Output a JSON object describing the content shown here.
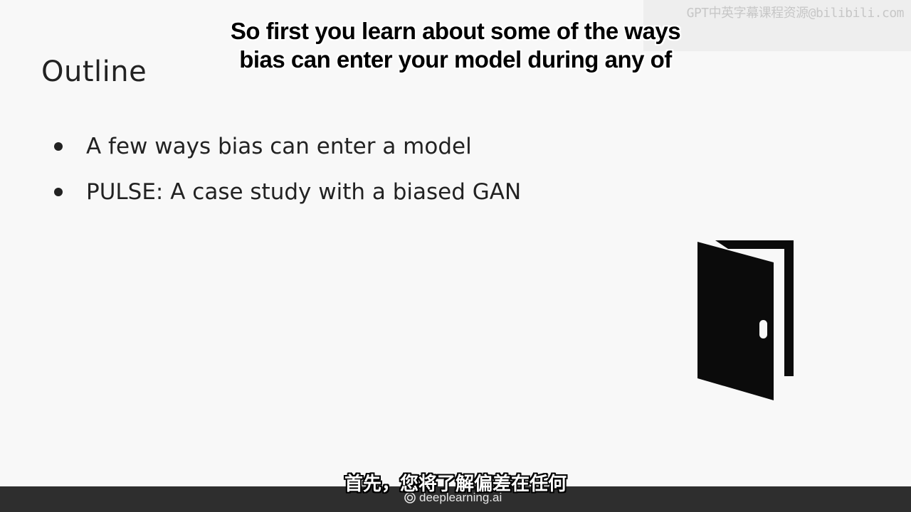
{
  "slide": {
    "title": "Outline",
    "bullets": [
      "A few ways bias can enter a model",
      "PULSE: A case study with a biased GAN"
    ],
    "illustration_icon": "open-door-icon"
  },
  "subtitles": {
    "english_line_1": "So first you learn about some of the ways",
    "english_line_2": "bias can enter your model during any of",
    "chinese": "首先，您将了解偏差在任何"
  },
  "watermark": {
    "text": "GPT中英字幕课程资源@bilibili.com"
  },
  "footer": {
    "brand": "deeplearning.ai",
    "brand_icon": "deeplearning-logo-icon"
  },
  "colors": {
    "slide_background": "#f8f8f8",
    "text": "#222222",
    "footer_background": "#2e2e2e"
  }
}
